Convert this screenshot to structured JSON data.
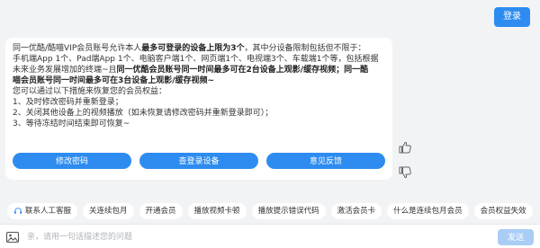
{
  "header": {
    "login_label": "登录"
  },
  "message": {
    "line1": {
      "pre": "同一优酷/酷喵VIP会员账号允许本人",
      "bold": "最多可登录的设备上限为3个",
      "post": "，其中分设备限制包括但不限于："
    },
    "line2": "手机端App 1个、Pad端App 1个、电脑客户端1个、网页端1个、电视端3个、车载端1个等，包括根据",
    "line3": {
      "pre": "未来业务发展增加的终端~且",
      "bold": "同一优酷会员账号同一时间最多可在2台设备上观影/缓存视频；同一酷"
    },
    "line4": {
      "bold": "喵会员账号同一时间最多可在3台设备上观影/缓存视频~"
    },
    "line5": "您可以通过以下措施来恢复您的会员权益：",
    "line6": "1、及时修改密码并重新登录；",
    "line7": "2、关闭其他设备上的视频播放（如未恢复请修改密码并重新登录即可）；",
    "line8": "3、等待冻结时间结束即可恢复~",
    "actions": [
      "修改密码",
      "查登录设备",
      "意见反馈"
    ]
  },
  "feedback": {
    "like_icon": "thumbs-up-icon",
    "dislike_icon": "thumbs-down-icon"
  },
  "quick_replies": [
    "联系人工客服",
    "关连续包月",
    "开通会员",
    "播放视频卡顿",
    "播放提示错误代码",
    "激活会员卡",
    "什么是连续包月会员",
    "会员权益失效"
  ],
  "input": {
    "placeholder": "亲，请用一句话描述您的问题",
    "send_label": "发送"
  },
  "colors": {
    "accent": "#2e8cf0",
    "send_disabled": "#a9cdf5",
    "background": "#f2f3f5"
  }
}
